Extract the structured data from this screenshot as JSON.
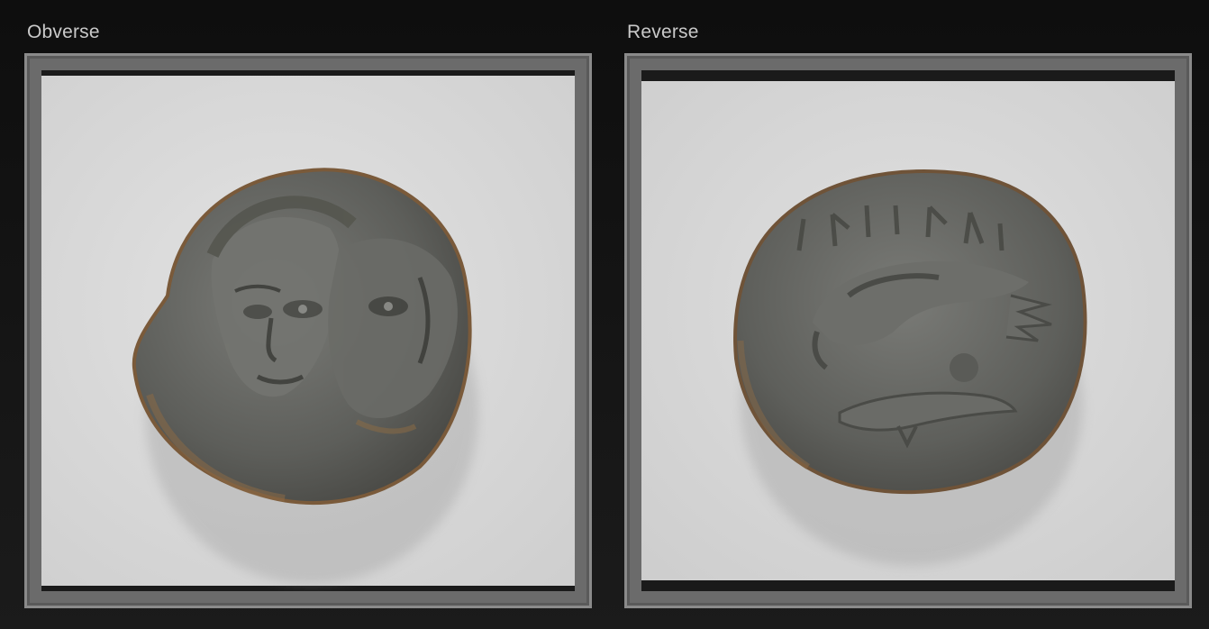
{
  "viewer": {
    "obverse": {
      "label": "Obverse",
      "image": "coin-obverse-twin-heads"
    },
    "reverse": {
      "label": "Reverse",
      "image": "coin-reverse-eagle-on-dolphin"
    }
  },
  "colors": {
    "background": "#141414",
    "frame": "#6b6b6b",
    "photo_backdrop": "#d9d9d9",
    "coin_silver": "#6e6f6b",
    "coin_patina": "#8a6a45"
  }
}
